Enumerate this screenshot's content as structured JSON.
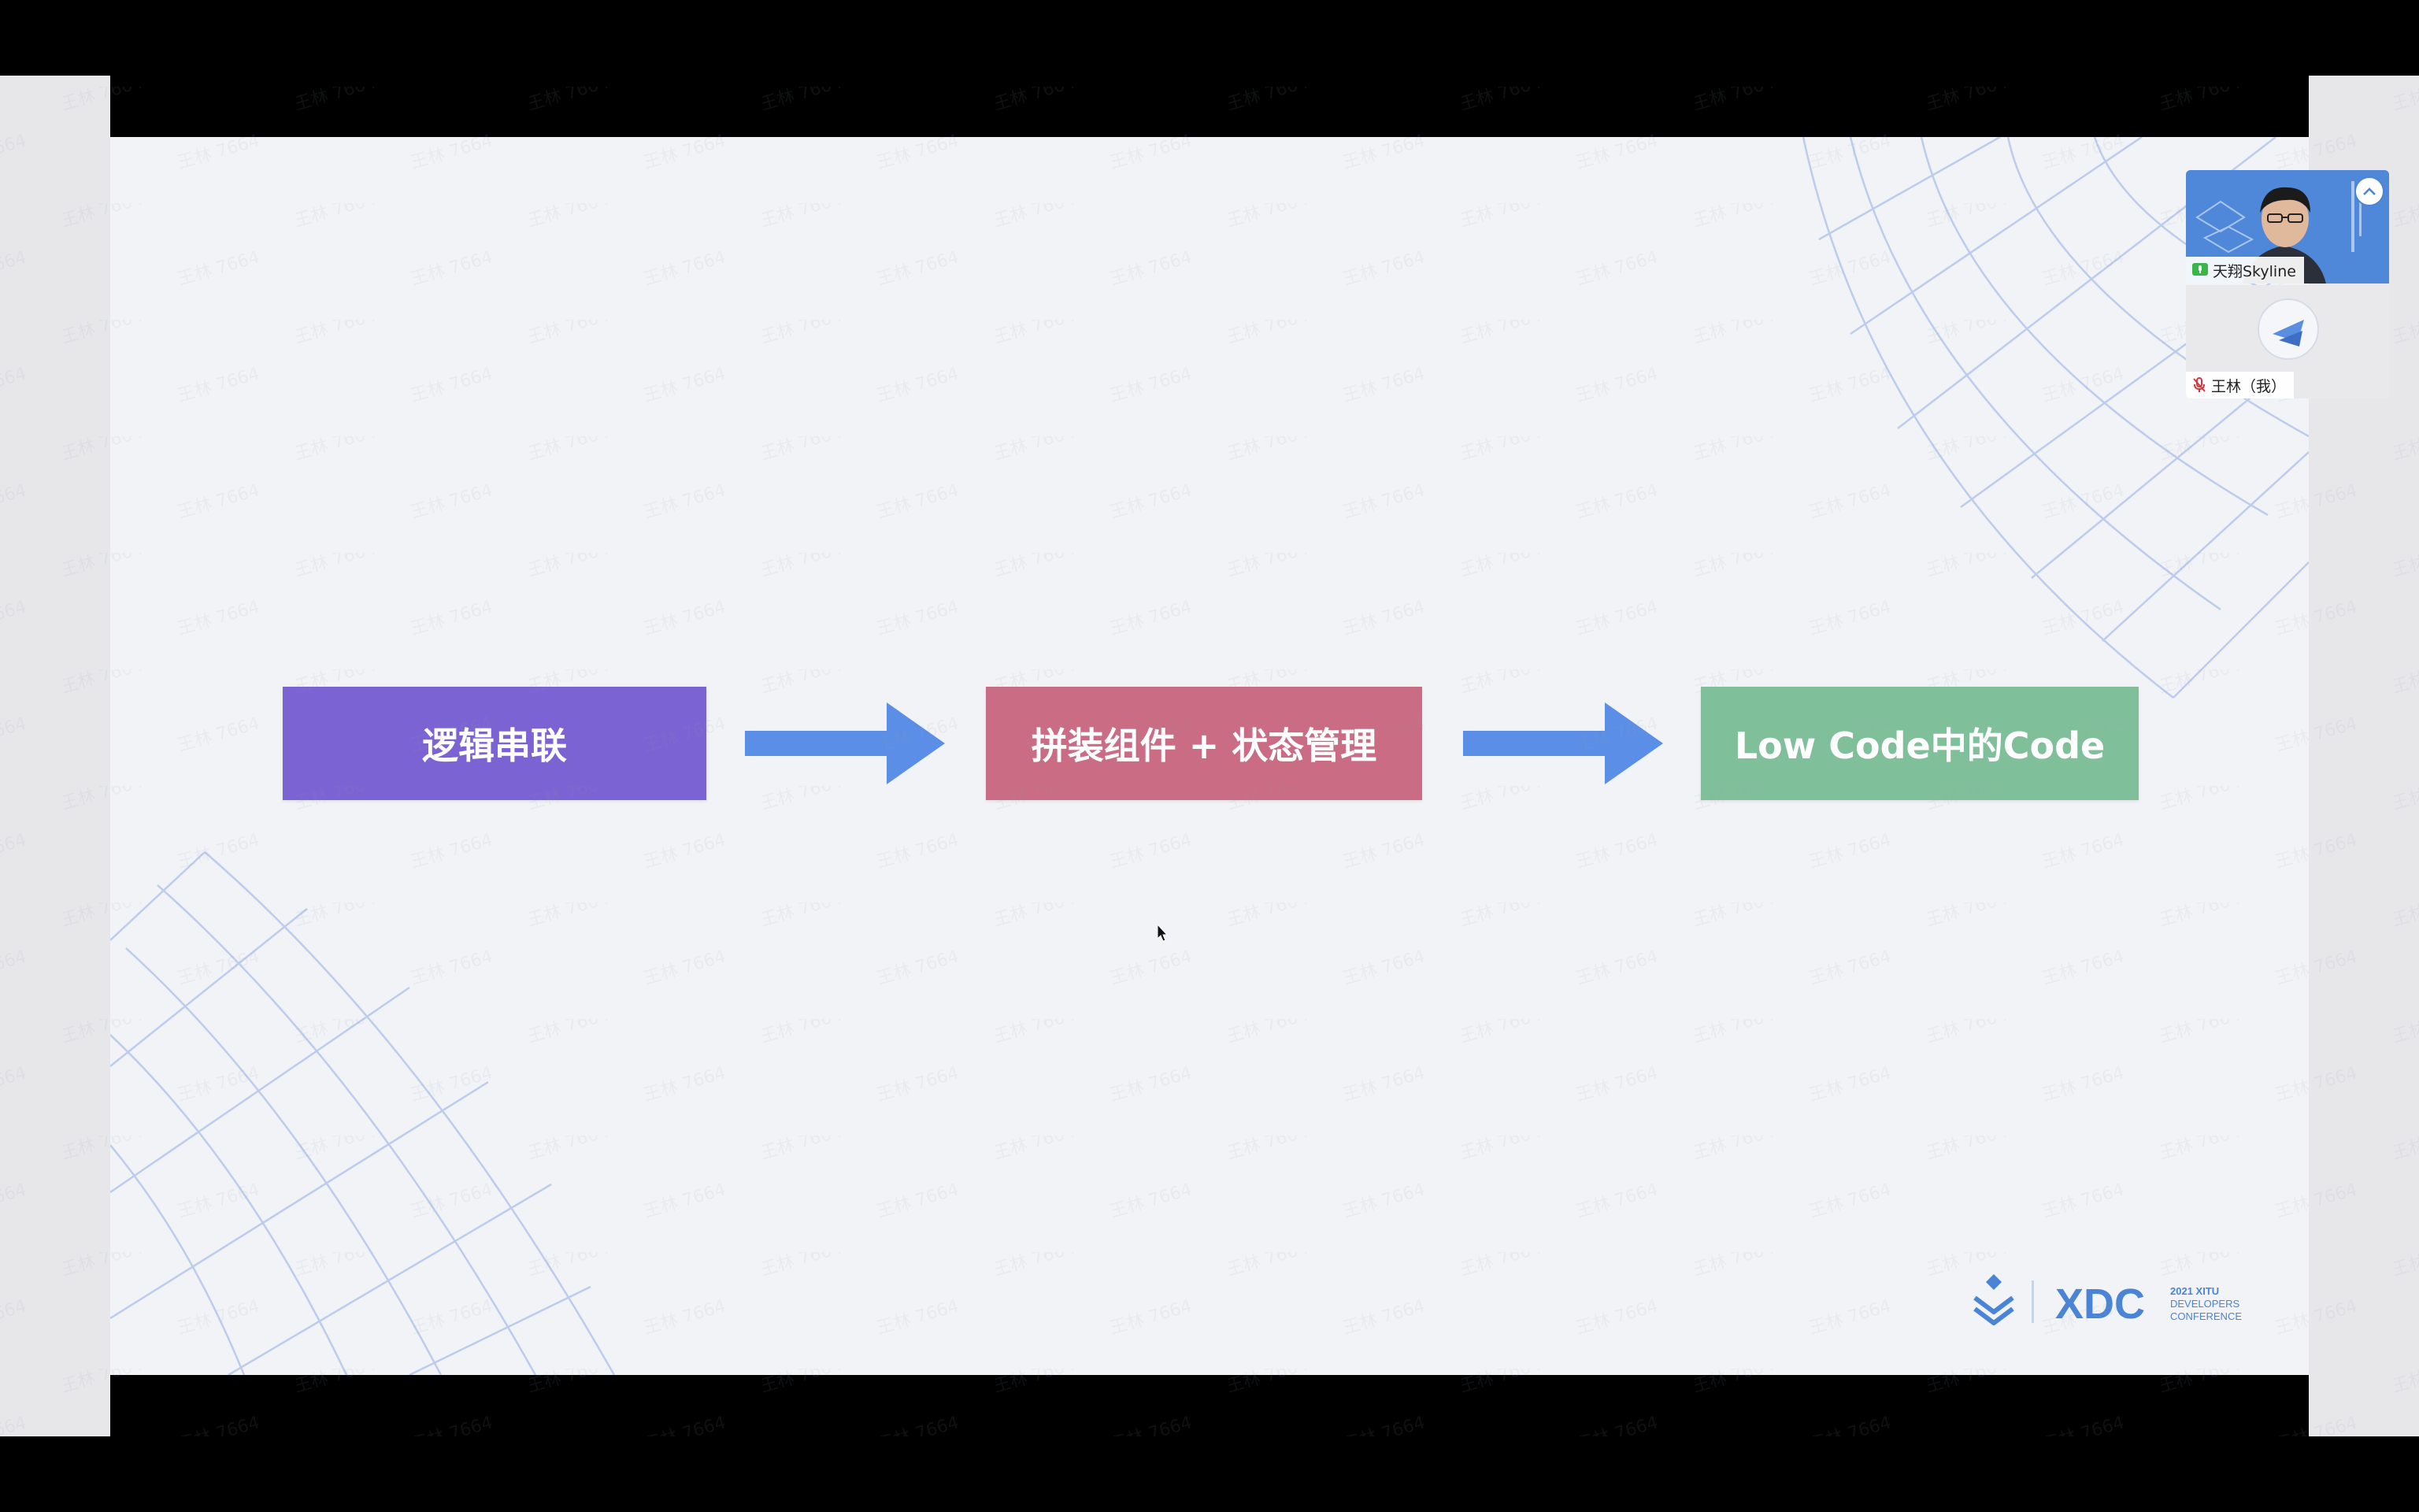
{
  "slide": {
    "boxes": [
      {
        "label": "逻辑串联",
        "color": "#7b63d3"
      },
      {
        "label": "拼装组件 + 状态管理",
        "color": "#c96c84"
      },
      {
        "label": "Low Code中的Code",
        "color": "#7fbf9a"
      }
    ],
    "arrow_color": "#5b8ee6",
    "background": "#f1f3f7"
  },
  "branding": {
    "logo_text": "XDC",
    "year_line": "2021 XITU",
    "line2": "DEVELOPERS",
    "line3": "CONFERENCE",
    "color": "#4a84d6"
  },
  "watermark": {
    "text": "王林 7664"
  },
  "participants": [
    {
      "name": "天翔Skyline",
      "mic": "on"
    },
    {
      "name": "王林（我）",
      "mic": "muted"
    }
  ]
}
